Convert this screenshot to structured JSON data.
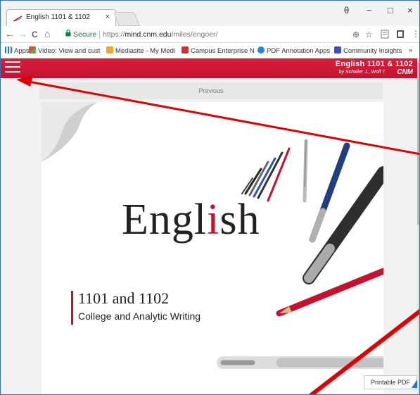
{
  "browser": {
    "tab": {
      "title": "English 1101 & 1102",
      "close": "×"
    },
    "window_controls": {
      "account": "θ",
      "minimize": "−",
      "maximize": "□",
      "close": "×"
    },
    "nav": {
      "back": "←",
      "forward": "→",
      "reload": "C",
      "home": "⌂"
    },
    "address": {
      "secure_label": "Secure",
      "separator": "|",
      "url_scheme": "https://",
      "url_host": "mind.cnm.edu",
      "url_path": "/miles/engoer/",
      "zoom_icon": "⊕",
      "star_icon": "☆"
    },
    "bookmarks": [
      {
        "label": "Apps",
        "icon": "apps-grid-icon",
        "color": "#1a73e8"
      },
      {
        "label": "Video: View and cust",
        "icon": "video-icon",
        "color": "#4caf50"
      },
      {
        "label": "Mediasite - My Medi",
        "icon": "mediasite-icon",
        "color": "#f5a623"
      },
      {
        "label": "Campus Enterprise N",
        "icon": "campus-icon",
        "color": "#d32f2f"
      },
      {
        "label": "PDF Annotation Apps",
        "icon": "pdf-annotation-icon",
        "color": "#1e88e5"
      },
      {
        "label": "Community Insights",
        "icon": "community-icon",
        "color": "#3f51b5"
      }
    ],
    "bookmarks_overflow": "»"
  },
  "app": {
    "header": {
      "book_title": "English 1101 & 1102",
      "author": "by Schaller J., Wolf T.",
      "logo": "CNM"
    },
    "previous_label": "Previous",
    "cover": {
      "word_pre": "Engl",
      "word_accent": "i",
      "word_post": "sh",
      "title": "1101 and 1102",
      "subtitle": "College and Analytic Writing"
    },
    "printable_label": "Printable PDF"
  },
  "colors": {
    "brand_red": "#c8102e",
    "annotation_red": "#e00000",
    "secure_green": "#0b8043"
  }
}
